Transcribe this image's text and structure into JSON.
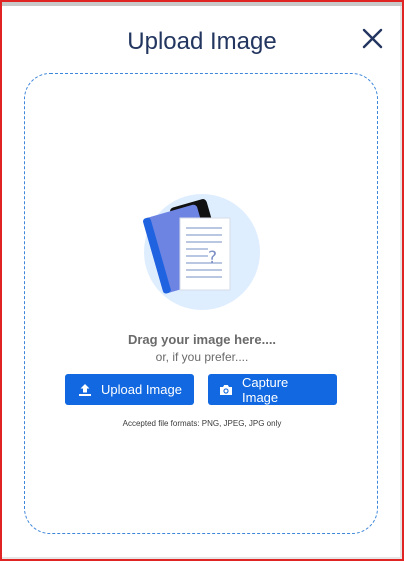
{
  "dialog": {
    "title": "Upload Image"
  },
  "dropzone": {
    "drag_text": "Drag your image here....",
    "alt_text": "or, if you prefer....",
    "upload_button_label": "Upload Image",
    "capture_button_label": "Capture Image",
    "formats_text": "Accepted file formats: PNG, JPEG, JPG only"
  },
  "icons": {
    "close": "close-icon",
    "upload": "upload-icon",
    "camera": "camera-icon",
    "illustration": "image-document-illustration"
  },
  "colors": {
    "title": "#233660",
    "accent": "#1168e0",
    "dashed_border": "#3d86d9",
    "frame_border": "#e02424"
  }
}
